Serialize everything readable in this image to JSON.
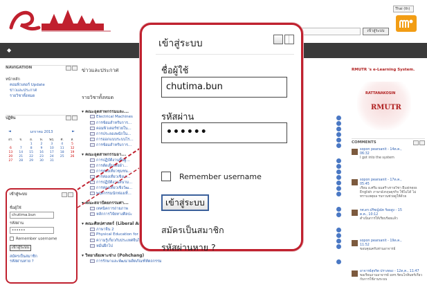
{
  "header": {
    "lang_select": "Thai (th)",
    "login_button": "เข้าสู่ระบบ"
  },
  "navigation": {
    "title": "NAVIGATION",
    "items": [
      "หน้าหลัก",
      "คอมพิวเตอร์ Update",
      "ข่าวและประกาศ",
      "รายวิชาทั้งหมด"
    ]
  },
  "calendar": {
    "title": "ปฏิทิน",
    "prev": "◄",
    "month": "มกราคม 2013",
    "next": "►",
    "days": [
      "อา.",
      "จ.",
      "อ.",
      "พ.",
      "พฤ.",
      "ศ.",
      "ส."
    ],
    "dates": [
      "",
      "",
      "1",
      "2",
      "3",
      "4",
      "5",
      "6",
      "7",
      "8",
      "9",
      "10",
      "11",
      "12",
      "13",
      "14",
      "15",
      "16",
      "17",
      "18",
      "19",
      "20",
      "21",
      "22",
      "23",
      "24",
      "25",
      "26",
      "27",
      "28",
      "29",
      "30",
      "31",
      "",
      ""
    ]
  },
  "small_login": {
    "title": "เข้าสู่ระบบ",
    "username_label": "ชื่อผู้ใช้",
    "username_value": "chutima.bun",
    "password_label": "รหัสผ่าน",
    "password_value": "••••••",
    "remember": "Remember username",
    "button": "เข้าสู่ระบบ",
    "signup": "สมัครเป็นสมาชิก",
    "forgot": "รหัสผ่านหาย ?"
  },
  "main": {
    "title": "ข่าวและประกาศ",
    "subtitle": "รายวิชาทั้งหมด",
    "categories": [
      {
        "label": "▾ คณะอุตสาหกรรมและ...",
        "courses": [
          "Electrical Machines",
          "การซ้อมสำหรับการ...",
          "คอมพิวเตอร์ช่วยใน...",
          "การประลองพนักใน...",
          "การออกแบบระบบไร...",
          "การซ้อมสำหรับการ..."
        ]
      },
      {
        "label": "▾ คณะอุตสาหกรรมอา...",
        "courses": [
          "การปฏิบัติงานพื้นฐ...",
          "การตัดเย็บเสื้อผ้า...",
          "การท่องเที่ยวชุมชน...",
          "การท่องเที่ยวเชิงเก...",
          "การปฏิบัติงานสนาม...",
          "การท่องเที่ยวเชิงวัฒ...",
          "พฤติกรรมนักท่องเที่..."
        ]
      },
      {
        "label": "▾ คณะสถาปัตยกรรมศา...",
        "courses": [
          "เทคนิคการถ่ายภาพ",
          "หลักการวิจัยทางศิลปะ"
        ]
      },
      {
        "label": "▾ คณะศิลปศาสตร์ (Liberal Arts)",
        "courses": [
          "ภาษาจีน 2",
          "Physical Education for Quality of Life",
          "ความรู้เกี่ยวกับประเทศจีนโดยสังเขป ( Introduction to China )",
          "หมั่นฝึกไป"
        ]
      },
      {
        "label": "▾ วิทยาลัยเพาะช่าง (Pohchang)",
        "courses": [
          "การรักษาและพัฒนาผลิตภัณฑ์หัตถกรรม"
        ]
      }
    ]
  },
  "right": {
    "title": "RMUTR 's e-Learning System.",
    "logo_text": "RMUTR",
    "logo_ring": "RATTANAKOSIN",
    "comments_title": "COMMENTS",
    "comments": [
      {
        "who": "sopon pearsanit - 14ต.ค.,",
        "time": "06:32",
        "text": "I got into the system"
      },
      {
        "who": "sopon pearsanit - 17ต.ค.,",
        "time": "05:45",
        "text": "เรียน อ.ศรีม ผมสร้างรายวิชา Business English ภาษาอังกฤษธุรกิจ ใช้ไม่ได้ ไม่ทราบเหตุผล รบกวนช่วยดูให้ด้วย"
      },
      {
        "who": "รศ.ดร.ปรีชญ์ณัท ร้อยสูง - 15",
        "time": "ต.ค., 10:12",
        "text": "ดำเนินการให้เรียบร้อยแล้ว"
      },
      {
        "who": "sopon pearsanit - 19ต.ค.,",
        "time": "11:52",
        "text": "ขอบคุณครับท่านอาจารย์"
      },
      {
        "who": "อาจารย์สุจริต ปรางทอง - 12ต.ค., 11:47",
        "time": "",
        "text": "ขอเรียนถามอาจารย์ มทร.รัตนโกสินทร์เกี่ยวกับการใช้งานระบบ"
      }
    ]
  },
  "zoom": {
    "title": "เข้าสู่ระบบ",
    "username_label": "ชื่อผู้ใช้",
    "username_value": "chutima.bun",
    "password_label": "รหัสผ่าน",
    "password_value": "••••••",
    "remember": "Remember username",
    "button": "เข้าสู่ระบบ",
    "signup": "สมัครเป็นสมาชิก",
    "forgot": "รหัสผ่านหาย ?"
  },
  "colors": {
    "highlight": "#c0202e",
    "link": "#2a5db0",
    "navbar": "#3a3a3a",
    "brand_orange": "#f29d14"
  }
}
